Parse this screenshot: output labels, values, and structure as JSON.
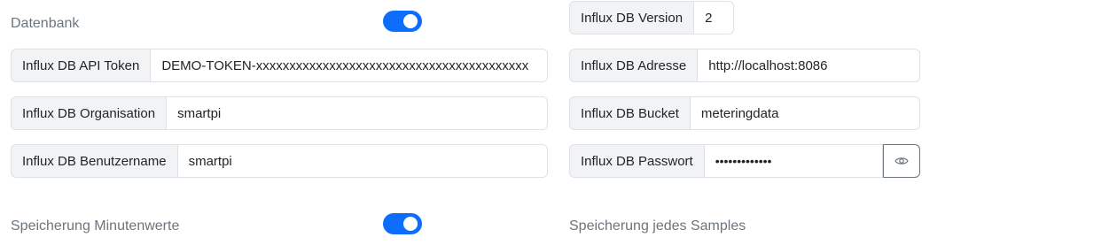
{
  "database": {
    "label": "Datenbank",
    "enabled": true
  },
  "fields": {
    "api_token": {
      "label": "Influx DB API Token",
      "value": "DEMO-TOKEN-xxxxxxxxxxxxxxxxxxxxxxxxxxxxxxxxxxxxxxxxx"
    },
    "organisation": {
      "label": "Influx DB Organisation",
      "value": "smartpi"
    },
    "username": {
      "label": "Influx DB Benutzername",
      "value": "smartpi"
    },
    "version": {
      "label": "Influx DB Version",
      "value": "2"
    },
    "address": {
      "label": "Influx DB Adresse",
      "value": "http://localhost:8086"
    },
    "bucket": {
      "label": "Influx DB Bucket",
      "value": "meteringdata"
    },
    "password": {
      "label": "Influx DB Passwort",
      "value": "•••••••••••••"
    }
  },
  "minute_values": {
    "label": "Speicherung Minutenwerte",
    "enabled": true
  },
  "samples": {
    "label": "Speicherung jedes Samples"
  },
  "colors": {
    "accent": "#0d6efd",
    "addon_bg": "#f2f3f5",
    "border": "#dee2e6",
    "muted_text": "#6c757d"
  },
  "icons": {
    "password_toggle": "eye-icon"
  }
}
